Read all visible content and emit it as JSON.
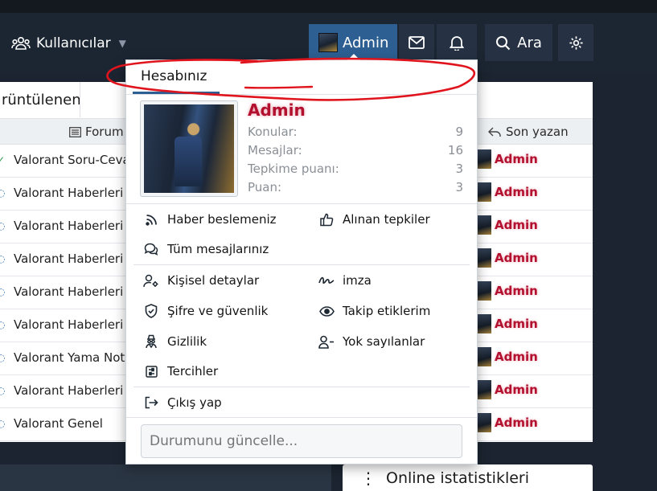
{
  "nav": {
    "users_label": "Kullanıcılar",
    "admin_label": "Admin",
    "search_label": "Ara",
    "brand_blue": "#2d5f93",
    "nav_bg": "#1c2633"
  },
  "background": {
    "tab_label": "rüntülenen",
    "col_forum": "Forum",
    "col_last": "Son yazan",
    "rows": [
      {
        "forum": "Valorant Soru-Ceva",
        "user": "Admin"
      },
      {
        "forum": "Valorant Haberleri",
        "user": "Admin"
      },
      {
        "forum": "Valorant Haberleri",
        "user": "Admin"
      },
      {
        "forum": "Valorant Haberleri",
        "user": "Admin"
      },
      {
        "forum": "Valorant Haberleri",
        "user": "Admin"
      },
      {
        "forum": "Valorant Haberleri",
        "user": "Admin"
      },
      {
        "forum": "Valorant Yama Notl",
        "user": "Admin"
      },
      {
        "forum": "Valorant Haberleri",
        "user": "Admin"
      },
      {
        "forum": "Valorant Genel",
        "user": "Admin"
      }
    ],
    "online_label": "Online istatistikleri"
  },
  "menu": {
    "tab_label": "Hesabınız",
    "name": "Admin",
    "name_color": "#b3102f",
    "stats": [
      {
        "label": "Konular:",
        "value": "9"
      },
      {
        "label": "Mesajlar:",
        "value": "16"
      },
      {
        "label": "Tepkime puanı:",
        "value": "3"
      },
      {
        "label": "Puan:",
        "value": "3"
      }
    ],
    "items": {
      "feed": "Haber beslemeniz",
      "reactions": "Alınan tepkiler",
      "posts": "Tüm mesajlarınız",
      "details": "Kişisel detaylar",
      "signature": "imza",
      "security": "Şifre ve güvenlik",
      "following": "Takip etiklerim",
      "privacy": "Gizlilik",
      "ignored": "Yok sayılanlar",
      "prefs": "Tercihler",
      "logout": "Çıkış yap"
    },
    "status_placeholder": "Durumunu güncelle..."
  }
}
